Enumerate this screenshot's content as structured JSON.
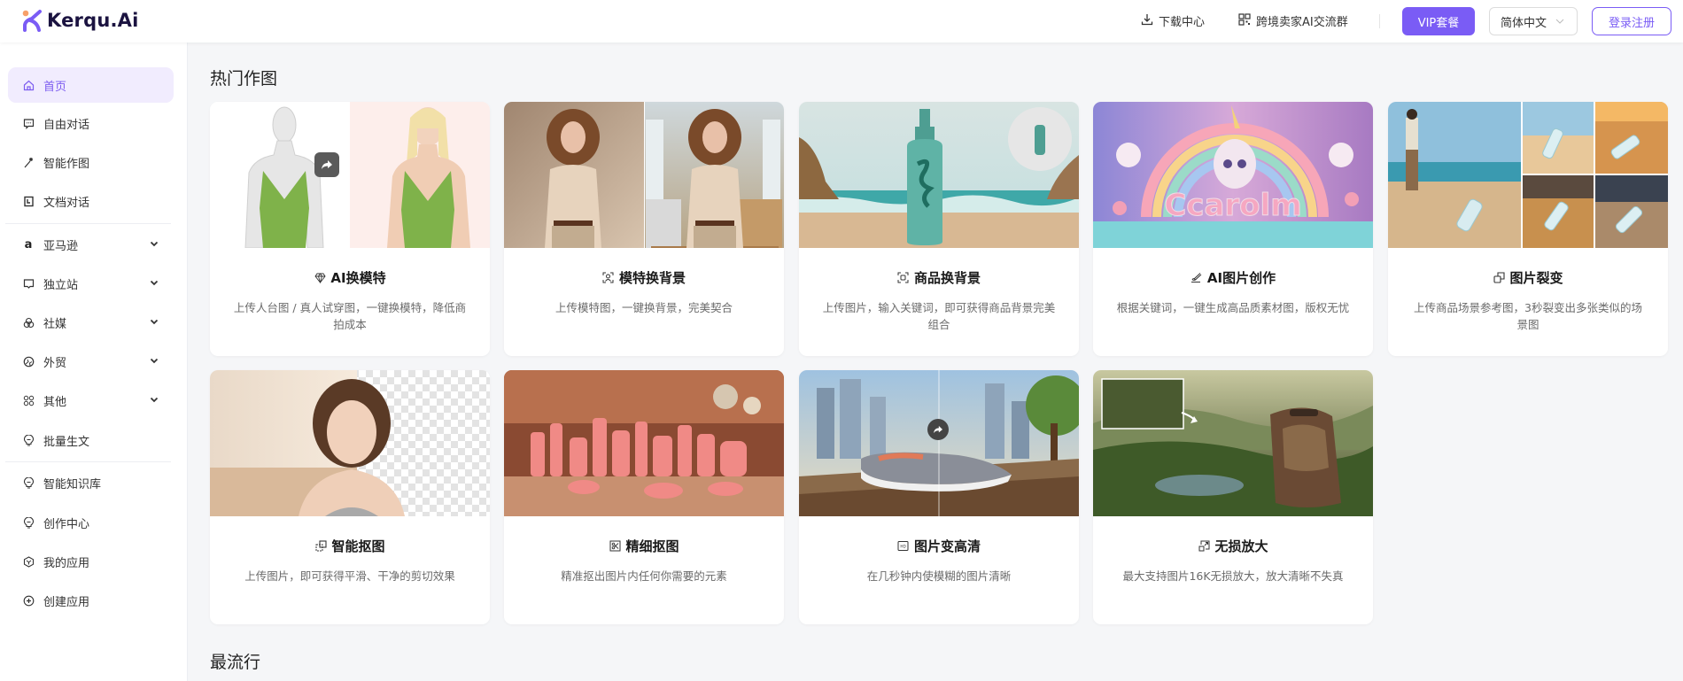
{
  "header": {
    "logo_text": "Kerqu.Ai",
    "download_label": "下载中心",
    "community_label": "跨境卖家AI交流群",
    "vip_label": "VIP套餐",
    "language_selected": "简体中文",
    "login_label": "登录注册"
  },
  "colors": {
    "accent": "#7a5cf5",
    "active_bg": "#f1ecfe",
    "page_bg": "#f5f6f8"
  },
  "sidebar": {
    "items": [
      {
        "label": "首页",
        "icon": "home-icon",
        "active": true
      },
      {
        "label": "自由对话",
        "icon": "chat-icon"
      },
      {
        "label": "智能作图",
        "icon": "magic-wand-icon"
      },
      {
        "label": "文档对话",
        "icon": "document-icon"
      },
      {
        "label": "亚马逊",
        "icon": "amazon-icon",
        "expandable": true
      },
      {
        "label": "独立站",
        "icon": "store-icon",
        "expandable": true
      },
      {
        "label": "社媒",
        "icon": "social-icon",
        "expandable": true
      },
      {
        "label": "外贸",
        "icon": "globe-icon",
        "expandable": true
      },
      {
        "label": "其他",
        "icon": "apps-icon",
        "expandable": true
      },
      {
        "label": "批量生文",
        "icon": "bulb-icon"
      },
      {
        "label": "智能知识库",
        "icon": "bulb-icon"
      },
      {
        "label": "创作中心",
        "icon": "bulb-icon"
      },
      {
        "label": "我的应用",
        "icon": "cube-icon"
      },
      {
        "label": "创建应用",
        "icon": "plus-circle-icon"
      }
    ]
  },
  "main": {
    "hot_section_title": "热门作图",
    "popular_section_title": "最流行",
    "cards": [
      {
        "title": "AI换模特",
        "icon": "diamond-icon",
        "desc": "上传人台图 / 真人试穿图，一键换模特，降低商拍成本"
      },
      {
        "title": "模特换背景",
        "icon": "person-frame-icon",
        "desc": "上传模特图，一键换背景，完美契合"
      },
      {
        "title": "商品换背景",
        "icon": "scan-frame-icon",
        "desc": "上传图片，输入关键词，即可获得商品背景完美组合"
      },
      {
        "title": "AI图片创作",
        "icon": "brush-icon",
        "desc": "根据关键词，一键生成高品质素材图，版权无忧"
      },
      {
        "title": "图片裂变",
        "icon": "copy-icon",
        "desc": "上传商品场景参考图，3秒裂变出多张类似的场景图"
      },
      {
        "title": "智能抠图",
        "icon": "cutout-icon",
        "desc": "上传图片，即可获得平滑、干净的剪切效果"
      },
      {
        "title": "精细抠图",
        "icon": "scissors-icon",
        "desc": "精准抠出图片内任何你需要的元素"
      },
      {
        "title": "图片变高清",
        "icon": "hd-icon",
        "desc": "在几秒钟内使模糊的图片清晰"
      },
      {
        "title": "无损放大",
        "icon": "expand-icon",
        "desc": "最大支持图片16K无损放大，放大清晰不失真"
      }
    ]
  }
}
